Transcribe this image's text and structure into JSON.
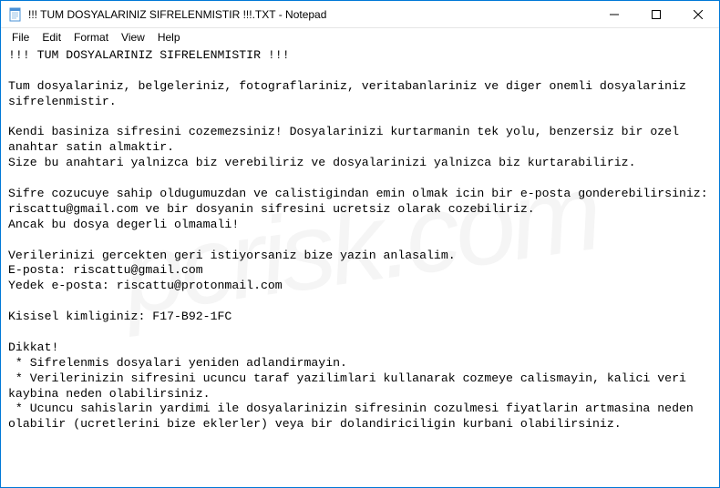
{
  "titlebar": {
    "title": "!!! TUM DOSYALARINIZ SIFRELENMISTIR !!!.TXT - Notepad"
  },
  "menubar": {
    "items": [
      "File",
      "Edit",
      "Format",
      "View",
      "Help"
    ]
  },
  "content": {
    "text": "!!! TUM DOSYALARINIZ SIFRELENMISTIR !!!\n\nTum dosyalariniz, belgeleriniz, fotograflariniz, veritabanlariniz ve diger onemli dosyalariniz sifrelenmistir.\n\nKendi basiniza sifresini cozemezsiniz! Dosyalarinizi kurtarmanin tek yolu, benzersiz bir ozel anahtar satin almaktir.\nSize bu anahtari yalnizca biz verebiliriz ve dosyalarinizi yalnizca biz kurtarabiliriz.\n\nSifre cozucuye sahip oldugumuzdan ve calistigindan emin olmak icin bir e-posta gonderebilirsiniz: riscattu@gmail.com ve bir dosyanin sifresini ucretsiz olarak cozebiliriz.\nAncak bu dosya degerli olmamali!\n\nVerilerinizi gercekten geri istiyorsaniz bize yazin anlasalim.\nE-posta: riscattu@gmail.com\nYedek e-posta: riscattu@protonmail.com\n\nKisisel kimliginiz: F17-B92-1FC\n\nDikkat!\n * Sifrelenmis dosyalari yeniden adlandirmayin.\n * Verilerinizin sifresini ucuncu taraf yazilimlari kullanarak cozmeye calismayin, kalici veri kaybina neden olabilirsiniz.\n * Ucuncu sahislarin yardimi ile dosyalarinizin sifresinin cozulmesi fiyatlarin artmasina neden olabilir (ucretlerini bize eklerler) veya bir dolandiriciligin kurbani olabilirsiniz."
  },
  "watermark": {
    "text": "pcrisk.com"
  }
}
